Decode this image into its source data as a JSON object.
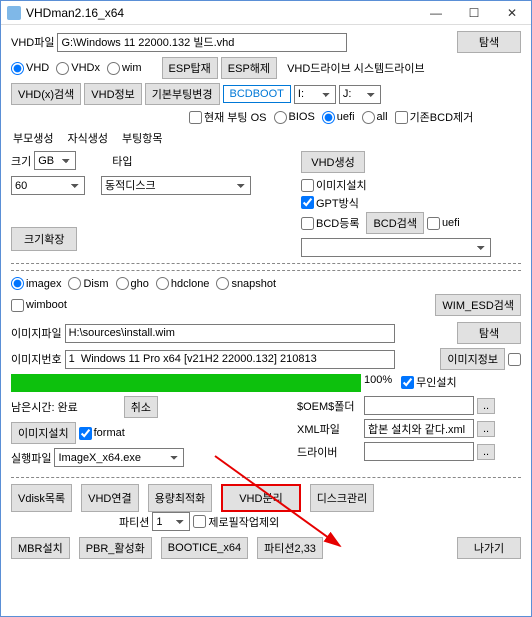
{
  "window": {
    "title": "VHDman2.16_x64"
  },
  "vhdfile": {
    "label": "VHD파일",
    "value": "G:\\Windows 11 22000.132 빌드.vhd",
    "browse": "탐색"
  },
  "radios1": {
    "vhd": "VHD",
    "vhdx": "VHDx",
    "wim": "wim"
  },
  "btns1": {
    "esp_browse": "ESP탑재",
    "esp_remove": "ESP해제",
    "vhd_drive": "VHD드라이브",
    "sys_drive": "시스템드라이브"
  },
  "btns2": {
    "vhdx_search": "VHD(x)검색",
    "vhd_info": "VHD정보",
    "boot_change": "기본부팅변경",
    "bcdboot": "BCDBOOT"
  },
  "sel1": {
    "i": "I:",
    "j": "J:"
  },
  "chk1": {
    "cur_os": "현재 부팅 OS"
  },
  "radios2": {
    "bios": "BIOS",
    "uefi": "uefi",
    "all": "all"
  },
  "chk2": {
    "bcd_base": "기존BCD제거"
  },
  "tabs": {
    "t1": "부모생성",
    "t2": "자식생성",
    "t3": "부팅항목"
  },
  "size": {
    "label": "크기",
    "unit": "GB",
    "val": "60"
  },
  "type": {
    "label": "타입",
    "val": "동적디스크"
  },
  "vhd_create": {
    "btn": "VHD생성",
    "img_install": "이미지설치",
    "gpt": "GPT방식",
    "bcd_reg": "BCD등록",
    "bcd_search": "BCD검색",
    "uefi": "uefi"
  },
  "size_expand": "크기확장",
  "imgtype": {
    "imagex": "imagex",
    "dism": "Dism",
    "gho": "gho",
    "hdclone": "hdclone",
    "snapshot": "snapshot",
    "wimboot": "wimboot",
    "wim_esd": "WIM_ESD검색"
  },
  "imgfile": {
    "label": "이미지파일",
    "val": "H:\\sources\\install.wim",
    "browse": "탐색"
  },
  "imgnum": {
    "label": "이미지번호",
    "val": "1  Windows 11 Pro x64 [v21H2 22000.132] 210813",
    "info": "이미지정보"
  },
  "progress": {
    "percent": "100%",
    "remain_lbl": "남은시간:",
    "remain_val": "완료",
    "cancel": "취소",
    "unattend": "무인설치"
  },
  "labels": {
    "oem": "$OEM$폴더",
    "xml": "XML파일",
    "driver": "드라이버",
    "xmlval": "합본 설치와 같다.xml"
  },
  "imginst": {
    "btn": "이미지설치",
    "format": "format"
  },
  "exec": {
    "label": "실행파일",
    "val": "ImageX_x64.exe"
  },
  "bottom1": {
    "vdisk": "Vdisk목록",
    "vhd_conn": "VHD연결",
    "optimize": "용량최적화",
    "vhd_split": "VHD분리",
    "disk_mgmt": "디스크관리"
  },
  "bottom2": {
    "part_lbl": "파티션",
    "part_val": "1",
    "zerofill": "제로필작업제외"
  },
  "bottom3": {
    "mbr": "MBR설치",
    "pbr": "PBR_활성화",
    "bootice": "BOOTICE_x64",
    "part233": "파티션2,33",
    "exit": "나가기"
  }
}
